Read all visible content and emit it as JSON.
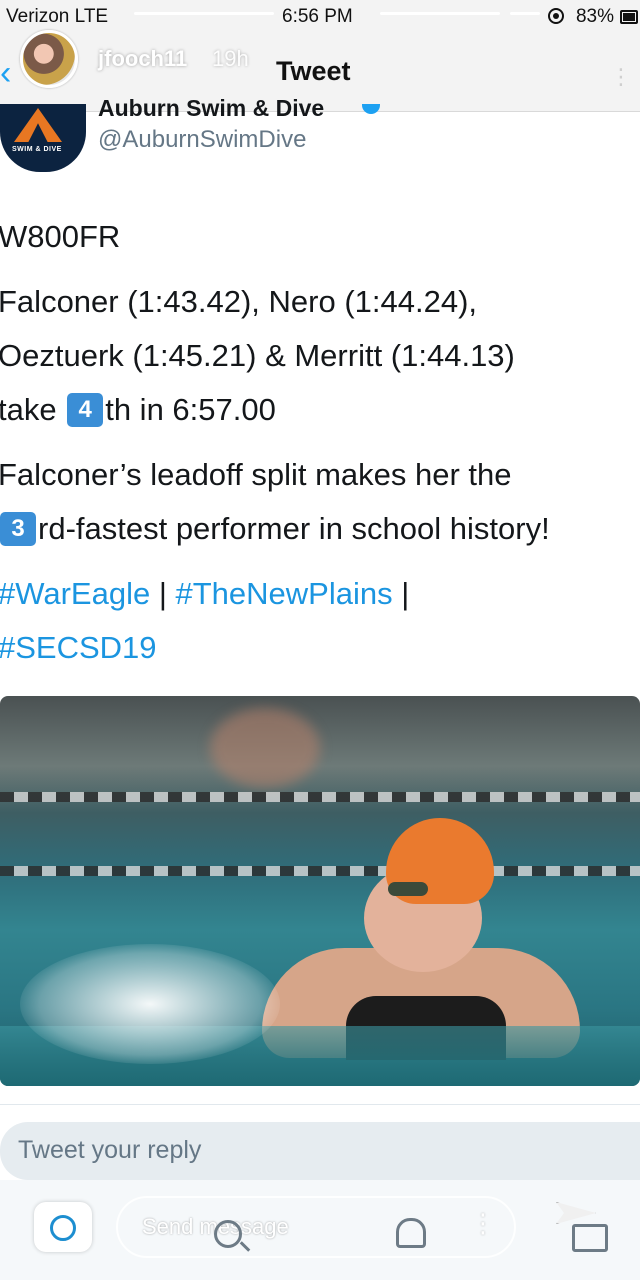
{
  "status_bar": {
    "carrier": "Verizon",
    "network": "LTE",
    "time": "6:56 PM",
    "battery": "83%"
  },
  "story": {
    "username": "jfooch11",
    "age": "19h"
  },
  "nav": {
    "back_icon": "chevron-left-icon",
    "title": "Tweet"
  },
  "tweet": {
    "author_name": "Auburn Swim & Dive",
    "author_handle": "@AuburnSwimDive",
    "logo_text": "SWIM & DIVE",
    "lines": {
      "l1": "W800FR",
      "l2": "Falconer (1:43.42), Nero (1:44.24),",
      "l3": "Oeztuerk (1:45.21) & Merritt (1:44.13)",
      "l4a": "take ",
      "l4b": "4",
      "l4c": "th in 6:57.00",
      "l5": "Falconer’s leadoff split makes her the",
      "l6a": "3",
      "l6b": "rd-fastest performer in school history!"
    },
    "hashtags": {
      "h1": "#WarEagle",
      "sep1": " | ",
      "h2": "#TheNewPlains",
      "sep2": " |",
      "h3": "#SECSD19"
    },
    "accent_color": "#1b95e0"
  },
  "reply": {
    "placeholder": "Tweet your reply"
  },
  "bottom_bar": {
    "send_message": "Send message"
  }
}
